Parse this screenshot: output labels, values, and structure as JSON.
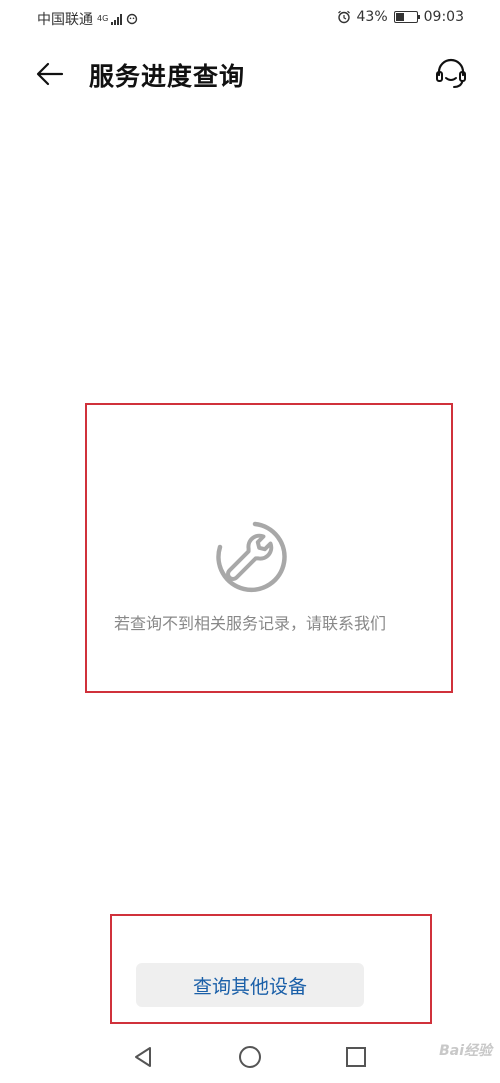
{
  "status_bar": {
    "carrier": "中国联通",
    "network_type": "4G",
    "battery_percent": "43%",
    "battery_level": 0.43,
    "time": "09:03"
  },
  "header": {
    "title": "服务进度查询",
    "back_icon": "arrow-left-icon",
    "support_icon": "headset-icon"
  },
  "empty_state": {
    "icon": "wrench-icon",
    "message": "若查询不到相关服务记录，请联系我们"
  },
  "actions": {
    "query_other_device_label": "查询其他设备"
  },
  "navigation": {
    "back_icon": "triangle-back-icon",
    "home_icon": "circle-home-icon",
    "recent_icon": "square-recent-icon"
  },
  "watermark": {
    "text": "Bai经验"
  },
  "colors": {
    "highlight_border": "#d0313b",
    "button_text": "#1a5fa8",
    "button_bg": "#efefef",
    "muted_text": "#888888"
  }
}
